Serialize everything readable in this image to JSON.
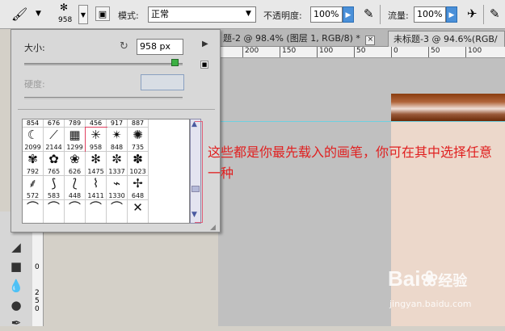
{
  "options_bar": {
    "brush_size_value": "958",
    "mode_label": "模式:",
    "mode_value": "正常",
    "opacity_label": "不透明度:",
    "opacity_value": "100%",
    "flow_label": "流量:",
    "flow_value": "100%"
  },
  "tabs": [
    {
      "label": "题-2 @ 98.4% (图层 1, RGB/8) *"
    },
    {
      "label": "未标题-3 @ 94.6%(RGB/"
    }
  ],
  "ruler_labels": [
    "200",
    "150",
    "100",
    "50",
    "0",
    "50",
    "100"
  ],
  "vruler_labels": [
    "0",
    "0",
    "2",
    "5",
    "0"
  ],
  "brush_panel": {
    "size_label": "大小:",
    "size_value": "958 px",
    "hardness_label": "硬度:",
    "top_row": [
      "854",
      "676",
      "789",
      "456",
      "917",
      "887"
    ],
    "rows": [
      [
        "2099",
        "2144",
        "1299",
        "958",
        "848",
        "735"
      ],
      [
        "792",
        "765",
        "626",
        "1475",
        "1337",
        "1023"
      ],
      [
        "572",
        "583",
        "448",
        "1411",
        "1330",
        "648"
      ],
      [
        "",
        "",
        "",
        "",
        "",
        ""
      ]
    ]
  },
  "annotation": "这些都是你最先载入的画笔，你可在其中选择任意一种",
  "watermark": {
    "brand": "Bai",
    "brand2": "经验",
    "url": "jingyan.baidu.com"
  },
  "icons": {
    "brush": "brush-icon",
    "toggle": "toggle-panel-icon",
    "airbrush": "airbrush-icon",
    "tablet": "tablet-pressure-icon",
    "reset": "reset-icon",
    "new": "new-preset-icon"
  }
}
